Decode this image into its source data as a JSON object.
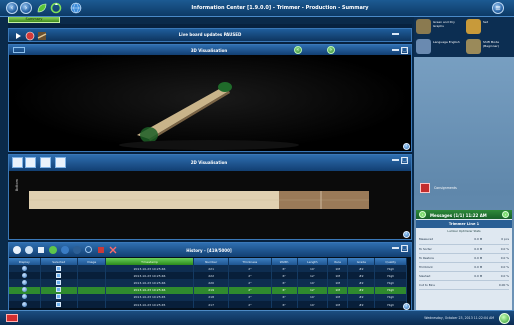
{
  "window": {
    "title": "Information Center [1.9.0.0] - Trimmer - Production - Summary",
    "summary_tab": "Summary"
  },
  "liveboard": {
    "title": "Live board updates PAUSED"
  },
  "viz3d": {
    "title": "3D Visualisation"
  },
  "viz2d": {
    "title": "2D Visualisation",
    "side_label": "Bottom"
  },
  "history": {
    "title": "History - [419/5000]",
    "columns": [
      "Display",
      "Selected",
      "Image",
      "Timestamp",
      "Number",
      "Thickness",
      "Width",
      "Length",
      "Rule",
      "Grade",
      "Quality"
    ],
    "sorted_column": "Timestamp",
    "rows": [
      {
        "timestamp": "2013-10-23 10:25:46",
        "number": "221",
        "thickness": "2\"",
        "width": "6\"",
        "length": "10'",
        "rule": "1M",
        "grade": "#2",
        "quality": "High",
        "selected": false
      },
      {
        "timestamp": "2013-10-23 10:25:46",
        "number": "222",
        "thickness": "2\"",
        "width": "6\"",
        "length": "12'",
        "rule": "1M",
        "grade": "#2",
        "quality": "High",
        "selected": false
      },
      {
        "timestamp": "2013-10-23 10:25:46",
        "number": "220",
        "thickness": "2\"",
        "width": "6\"",
        "length": "10'",
        "rule": "1M",
        "grade": "#2",
        "quality": "High",
        "selected": false
      },
      {
        "timestamp": "2013-10-23 10:25:46",
        "number": "219",
        "thickness": "2\"",
        "width": "6\"",
        "length": "12'",
        "rule": "1M",
        "grade": "#2",
        "quality": "High",
        "selected": true
      },
      {
        "timestamp": "2013-10-23 10:25:45",
        "number": "218",
        "thickness": "2\"",
        "width": "6\"",
        "length": "10'",
        "rule": "1M",
        "grade": "#2",
        "quality": "High",
        "selected": false
      },
      {
        "timestamp": "2013-10-23 10:25:45",
        "number": "217",
        "thickness": "2\"",
        "width": "6\"",
        "length": "10'",
        "rule": "1M",
        "grade": "#2",
        "quality": "High",
        "selected": false
      }
    ]
  },
  "sidebar": {
    "tiles": [
      {
        "label": "Green and Dry Graphs",
        "color": "#8a7a50"
      },
      {
        "label": "Set",
        "color": "#c89a3a"
      },
      {
        "label": "Language English",
        "color": "#6a8ab0"
      },
      {
        "label": "Shift Mode (Beginner)",
        "color": "#9a8a5a"
      }
    ],
    "consignments_label": "Consignments"
  },
  "messages": {
    "title": "Messages (1/1) 11:22 AM",
    "subtitle": "Trimmer Line 1",
    "caption": "Lumber Optimizer Stats",
    "rows": [
      {
        "label": "Measured",
        "value": "0.0 M",
        "pct": "0 pcs"
      },
      {
        "label": "To Sorter",
        "value": "0.0 M",
        "pct": "0.0 %"
      },
      {
        "label": "To Restore",
        "value": "0.0 M",
        "pct": "0.0 %"
      },
      {
        "label": "Trimblock",
        "value": "0.0 M",
        "pct": "0.0 %"
      },
      {
        "label": "Slashed",
        "value": "0.0 M",
        "pct": "0.0 %"
      },
      {
        "label": "Cut to Bins",
        "value": "",
        "pct": "0.00 %"
      }
    ]
  },
  "status": {
    "datetime": "Wednesday, October 23, 2013 11:22:04 AM"
  },
  "colors": {
    "accent": "#2e6eb0",
    "selected_row": "#2f8a2e",
    "board": "#d8c8a8"
  }
}
